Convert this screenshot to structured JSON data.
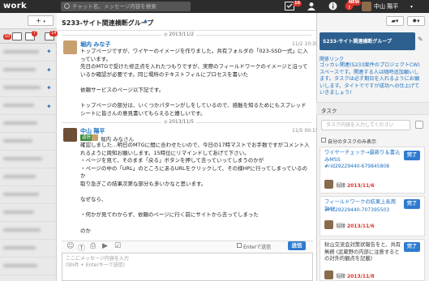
{
  "app": {
    "logo": "work"
  },
  "topbar": {
    "search_placeholder": "チャット名、メッセージ内容を検索",
    "badge_count": "10",
    "new_badge": "NEW",
    "user_name": "中山 陽平"
  },
  "left": {
    "plus_label": "+",
    "tab_badges": [
      "10",
      "7",
      "14"
    ]
  },
  "chat": {
    "room_title": "S233-サイト関連横断グループ",
    "date1": "2013/11/2",
    "date2": "2013/11/5",
    "msg1": {
      "sender": "堀内 みな子",
      "time": "11/2 10:38",
      "body": "トップページですが、ワイヤーのイメージを作りました。共有フォルダの「023-SSD一式」に入っています。\n先日のMTGで受けた修正点を入れたつもりですが、実際のフィールドワークのイメージと沿っているか確認が必要です。同じ場所のテキストフィルにプロセスを書いた\n\n依頼サービスのページ以下記です。\n\nトップページの部分は、いくつかパターンがしをしているので、感触を知るためにもスプレッドシートに皆さんの意見書いてもらえると嬉しいです。"
    },
    "msg2": {
      "sender": "中山 陽平",
      "time": "11/5 00:15",
      "reply_label": "返信",
      "reply_to": "堀内 みなさん",
      "body": "確認しました…明日のMTGに間に合わせたいので、今日の17時マストでお手数ですがコメント入れるように周知お願いします。15時位にリマインドしてあげて下さい。\n・ページを見て、そのまま「戻る」ボタンを押して去っていってしまうのかが\n・ページの中の「URL」のところにあるURLをクリックして、その様HPに行ってしまっているのか\n取り急ぎこの結果次第な部分も多いかなと思います。\n\nなぜなら、\n\n・何かが見てわからず、依頼のページに行く前にサイトから去ってしまった\n\nのか"
    },
    "composer": {
      "placeholder": "ここにメッセージ内容を入力\n(Shift + Enterキーで送信)",
      "send_label": "送信",
      "enter_send_label": "Enterで送信"
    }
  },
  "right": {
    "room_image_text": "S233-サイト関連横断グループ",
    "link_label": "関係リンク",
    "description": "ゴッカレ関連(S233案件のプロジェクトCW)スペースです。関連する人は随時追加願いします。タスクは必ず期日を入れるようにお願いします。タイトでですが成功への仕上げていきましょう!",
    "task_header": "タスク",
    "task_placeholder": "タスク内容を入力してください",
    "filter_label": "自分のタスクのみ表示",
    "tasks": [
      {
        "title": "ワイヤーチェック→最新り＆書込みMSS",
        "tag": "#rid29229440-679845808",
        "assignee": "堀腰",
        "due": "2013/11/6",
        "done_label": "完了"
      },
      {
        "title": "フィールドワークの結果上長用TMP",
        "tag": "#rid29229440-707395503",
        "assignee": "堀腰",
        "due": "2013/11/6",
        "done_label": "完了"
      },
      {
        "title": "秋山交流会対策状報告をと、共有無務 (武蔵野の内部に注意するとの対外的観点を記載)",
        "tag": "",
        "assignee": "堀腰",
        "due": "2013/11/8",
        "done_label": "完了"
      }
    ]
  },
  "colors": {
    "topbar": "#2c2c2c",
    "accent": "#2e7bcf",
    "alert": "#d9342b"
  }
}
